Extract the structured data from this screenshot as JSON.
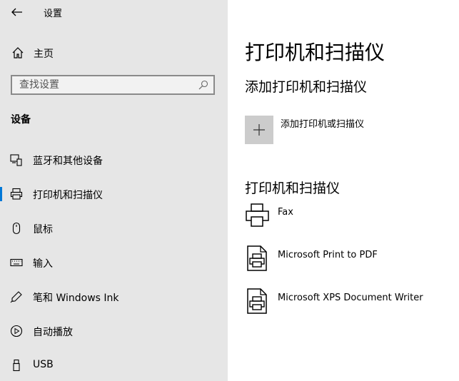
{
  "window": {
    "title": "设置"
  },
  "sidebar": {
    "home_label": "主页",
    "search": {
      "placeholder": "查找设置"
    },
    "section_heading": "设备",
    "items": [
      {
        "label": "蓝牙和其他设备",
        "icon": "bluetooth-devices-icon",
        "selected": false
      },
      {
        "label": "打印机和扫描仪",
        "icon": "printer-icon",
        "selected": true
      },
      {
        "label": "鼠标",
        "icon": "mouse-icon",
        "selected": false
      },
      {
        "label": "输入",
        "icon": "keyboard-icon",
        "selected": false
      },
      {
        "label": "笔和 Windows Ink",
        "icon": "pen-icon",
        "selected": false
      },
      {
        "label": "自动播放",
        "icon": "autoplay-icon",
        "selected": false
      },
      {
        "label": "USB",
        "icon": "usb-icon",
        "selected": false
      }
    ]
  },
  "main": {
    "page_title": "打印机和扫描仪",
    "add_section_title": "添加打印机和扫描仪",
    "add_button_label": "添加打印机或扫描仪",
    "devices_section_title": "打印机和扫描仪",
    "devices": [
      {
        "name": "Fax",
        "icon": "fax-icon"
      },
      {
        "name": "Microsoft Print to PDF",
        "icon": "pdf-printer-icon"
      },
      {
        "name": "Microsoft XPS Document Writer",
        "icon": "xps-printer-icon"
      }
    ]
  },
  "colors": {
    "accent": "#0078d7",
    "sidebar_bg": "#e6e6e6",
    "tile_bg": "#cccccc"
  }
}
